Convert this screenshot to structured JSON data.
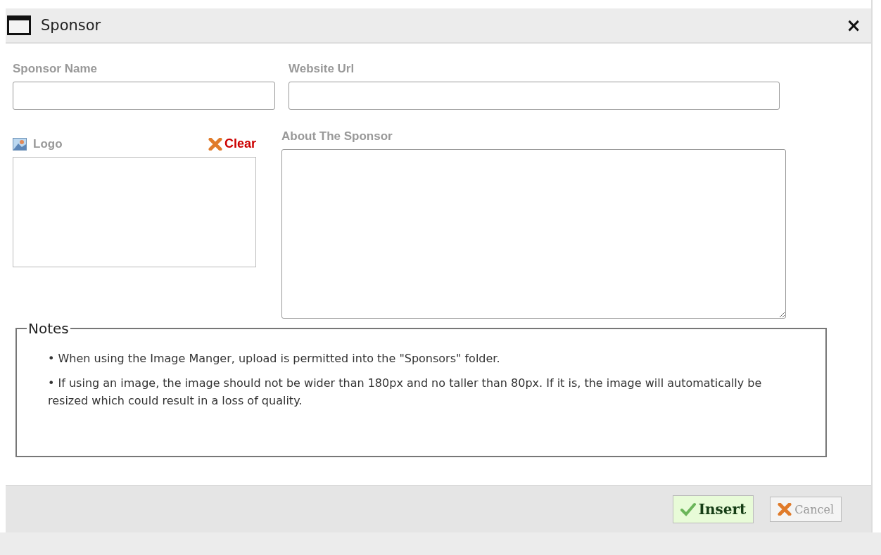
{
  "window": {
    "title": "Sponsor",
    "close": "×"
  },
  "fields": {
    "sponsor_name": {
      "label": "Sponsor Name"
    },
    "website_url": {
      "label": "Website Url"
    },
    "logo": {
      "label": "Logo",
      "clear": "Clear"
    },
    "about": {
      "label": "About The Sponsor"
    }
  },
  "notes": {
    "legend": "Notes",
    "items": [
      "• When using the Image Manger, upload is permitted into the \"Sponsors\" folder.",
      "• If using an image, the image should not be wider than 180px and no taller than 80px. If it is, the image will automatically be resized which could result in a loss of quality."
    ]
  },
  "buttons": [
    {
      "label": "Insert",
      "kind": "insert"
    },
    {
      "label": "Cancel",
      "kind": "cancel"
    }
  ]
}
